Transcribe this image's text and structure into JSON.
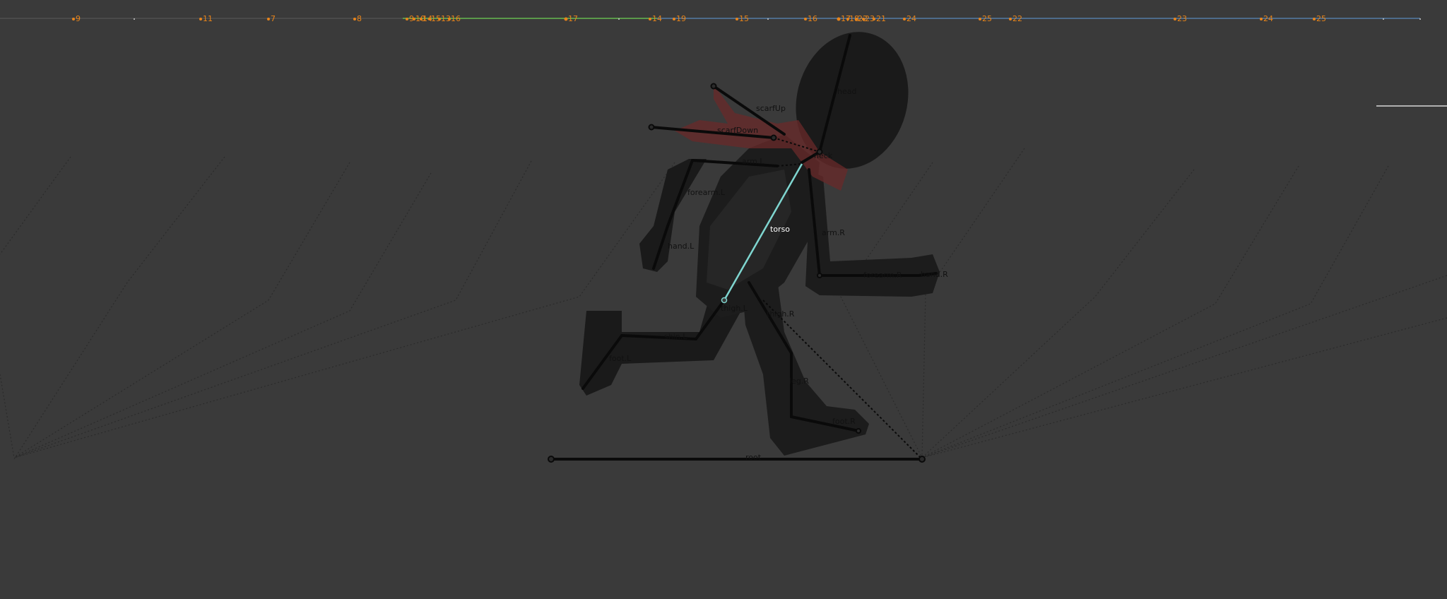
{
  "timeline": {
    "markers": [
      {
        "label": "9"
      },
      {
        "label": "11"
      },
      {
        "label": "7"
      },
      {
        "label": "8"
      },
      {
        "label": "9"
      },
      {
        "label": "10"
      },
      {
        "label": "14"
      },
      {
        "label": "15"
      },
      {
        "label": "13"
      },
      {
        "label": "16"
      },
      {
        "label": "17"
      },
      {
        "label": "14"
      },
      {
        "label": "19"
      },
      {
        "label": "15"
      },
      {
        "label": "16"
      },
      {
        "label": "17"
      },
      {
        "label": "18"
      },
      {
        "label": "22"
      },
      {
        "label": "23"
      },
      {
        "label": "21"
      },
      {
        "label": "24"
      },
      {
        "label": "25"
      },
      {
        "label": "22"
      },
      {
        "label": "23"
      },
      {
        "label": "24"
      },
      {
        "label": "25"
      }
    ],
    "colors": {
      "marker": "#e8841a",
      "track_left": "#4a4a4a",
      "track_mid": "#5b9a4a",
      "track_right": "#4d6b8a"
    }
  },
  "rig": {
    "bones": {
      "head": "head",
      "neck": "neck",
      "torso": "torso",
      "scarfUp": "scarfUp",
      "scarfDown": "scarfDown",
      "arm_L": "arm.L",
      "forearm_L": "forearm.L",
      "hand_L": "hand.L",
      "arm_R": "arm.R",
      "forearm_R": "forearm.R",
      "hand_R": "hand.R",
      "thigh_L": "thigh.L",
      "shin_L": "shin.L",
      "foot_L": "foot.L",
      "thigh_R": "thigh.R",
      "leg_R": "leg.R",
      "foot_R": "foot.R",
      "root": "root"
    },
    "active_bone": "torso",
    "colors": {
      "body": "#1c1c1c",
      "body_shade": "#262626",
      "scarf": "#6a2a2a",
      "active_bone": "#7fd6d0"
    }
  }
}
